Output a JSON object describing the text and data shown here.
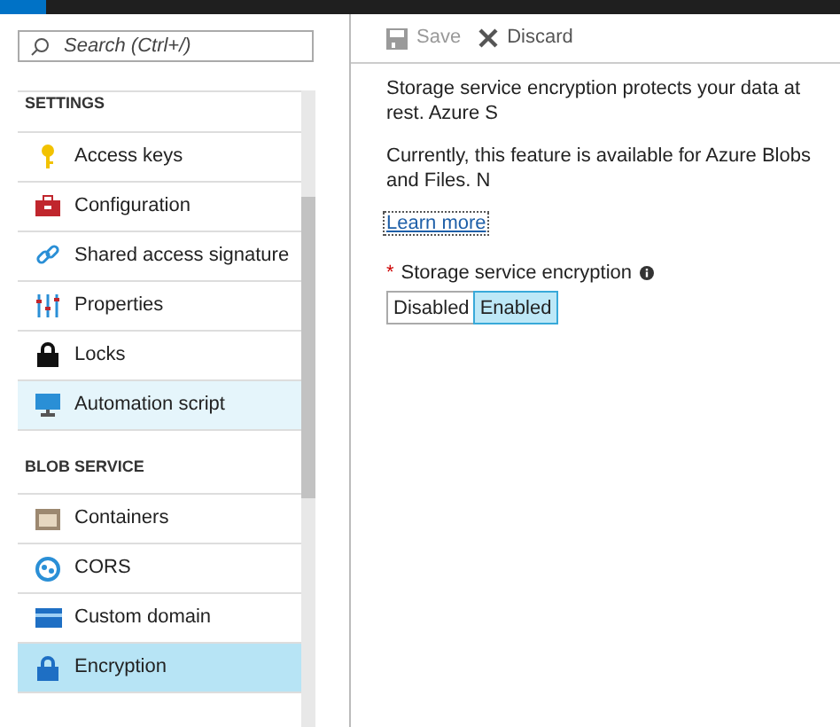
{
  "search": {
    "placeholder": "Search (Ctrl+/)"
  },
  "sidebar": {
    "sections": [
      {
        "title": "SETTINGS",
        "items": [
          {
            "label": "Access keys",
            "selected": false,
            "hovered": false
          },
          {
            "label": "Configuration",
            "selected": false,
            "hovered": false
          },
          {
            "label": "Shared access signature",
            "selected": false,
            "hovered": false
          },
          {
            "label": "Properties",
            "selected": false,
            "hovered": false
          },
          {
            "label": "Locks",
            "selected": false,
            "hovered": false
          },
          {
            "label": "Automation script",
            "selected": false,
            "hovered": true
          }
        ]
      },
      {
        "title": "BLOB SERVICE",
        "items": [
          {
            "label": "Containers",
            "selected": false,
            "hovered": false
          },
          {
            "label": "CORS",
            "selected": false,
            "hovered": false
          },
          {
            "label": "Custom domain",
            "selected": false,
            "hovered": false
          },
          {
            "label": "Encryption",
            "selected": true,
            "hovered": false
          }
        ]
      }
    ]
  },
  "toolbar": [
    {
      "label": "Save",
      "disabled": true
    },
    {
      "label": "Discard",
      "disabled": false
    }
  ],
  "content": {
    "paragraphs": [
      "Storage service encryption protects your data at rest. Azure S",
      "Currently, this feature is available for Azure Blobs and Files. N"
    ],
    "link": "Learn more",
    "field": {
      "label": "Storage service encryption",
      "required_mark": "*",
      "options": [
        {
          "label": "Disabled",
          "selected": false
        },
        {
          "label": "Enabled",
          "selected": true
        }
      ]
    }
  }
}
